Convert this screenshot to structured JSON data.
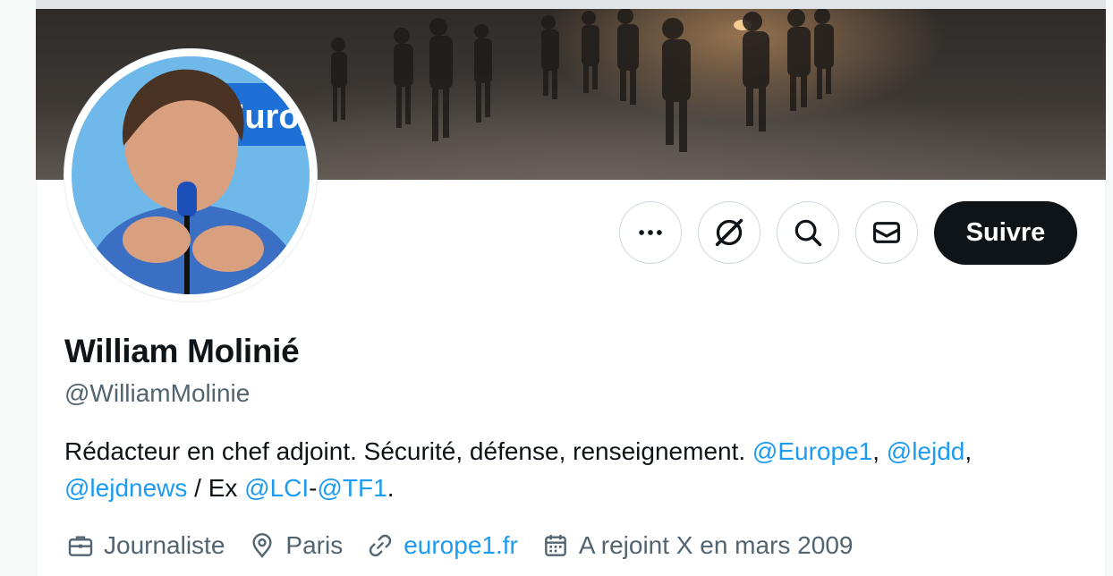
{
  "profile": {
    "display_name": "William Molinié",
    "handle": "@WilliamMolinie",
    "bio": {
      "text_1": "Rédacteur en chef adjoint. Sécurité, défense, renseignement. ",
      "mention_1": "@Europe1",
      "sep_1": ", ",
      "mention_2": "@lejdd",
      "sep_2": ",",
      "mention_3": "@lejdnews",
      "text_2": " / Ex ",
      "mention_4": "@LCI",
      "sep_3": "-",
      "mention_5": "@TF1",
      "text_3": "."
    },
    "meta": {
      "profession": "Journaliste",
      "location": "Paris",
      "website": "europe1.fr",
      "joined": "A rejoint X en mars 2009"
    },
    "avatar_text": "Europ"
  },
  "actions": {
    "follow_label": "Suivre",
    "more_icon": "more-horizontal-icon",
    "grok_icon": "grok-icon",
    "search_icon": "search-icon",
    "message_icon": "envelope-icon"
  },
  "colors": {
    "link": "#1d9bf0",
    "text": "#0f1419",
    "secondary": "#536471",
    "follow_bg": "#0f1419"
  }
}
